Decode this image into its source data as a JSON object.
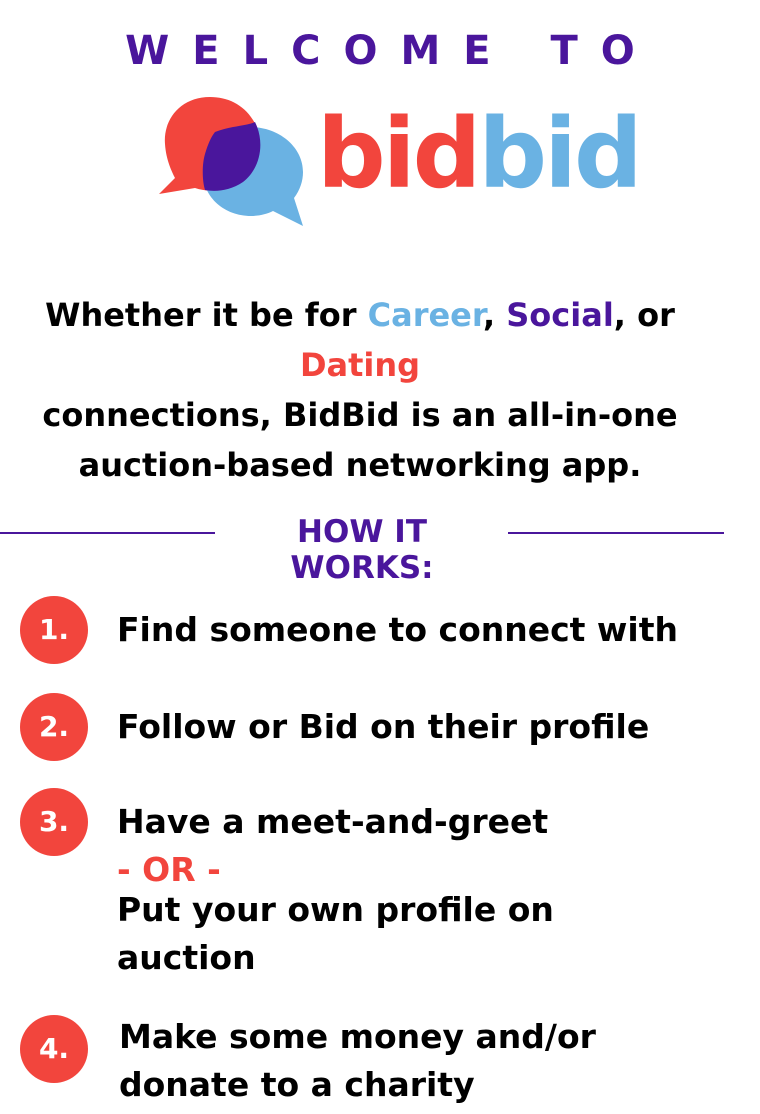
{
  "colors": {
    "purple": "#4a169c",
    "red": "#f2453d",
    "blue": "#6ab2e3",
    "overlap": "#4a169c",
    "text": "#000000"
  },
  "header": {
    "welcome": "WELCOME TO"
  },
  "logo": {
    "part1": "bid",
    "part2": "bid",
    "icon": "speech-bubbles-icon"
  },
  "tagline": {
    "prefix": "Whether it be for ",
    "career": "Career",
    "sep1": ", ",
    "social": "Social",
    "sep2": ", or ",
    "dating": "Dating",
    "line2": "connections, BidBid is an all-in-one",
    "line3": "auction-based networking app."
  },
  "how_it_works": {
    "title": "HOW IT WORKS:"
  },
  "steps": [
    {
      "number": "1.",
      "text": "Find someone to connect with"
    },
    {
      "number": "2.",
      "text": "Follow or Bid on their profile"
    },
    {
      "number": "3.",
      "text": "Have a meet-and-greet",
      "or": "- OR -",
      "alt_line1": "Put your own profile on",
      "alt_line2": "auction"
    },
    {
      "number": "4.",
      "line1": "Make some money and/or",
      "line2": "donate to a charity"
    }
  ]
}
